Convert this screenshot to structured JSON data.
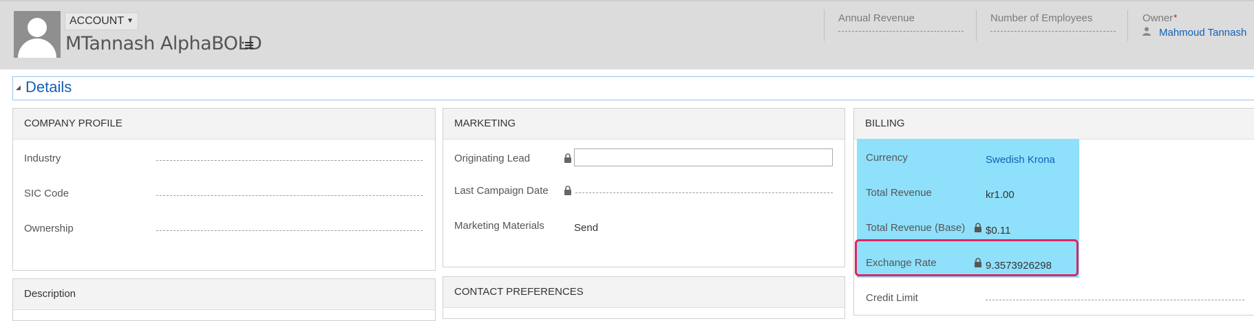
{
  "header": {
    "entity_type": "ACCOUNT",
    "record_name": "MTannash AlphaBOLD",
    "fields": {
      "annual_revenue_label": "Annual Revenue",
      "num_employees_label": "Number of Employees",
      "owner_label": "Owner",
      "owner_required_mark": "*",
      "owner_value": "Mahmoud Tannash"
    }
  },
  "details": {
    "title": "Details"
  },
  "company_profile": {
    "title": "COMPANY PROFILE",
    "rows": [
      {
        "label": "Industry"
      },
      {
        "label": "SIC Code"
      },
      {
        "label": "Ownership"
      }
    ]
  },
  "description": {
    "title": "Description"
  },
  "marketing": {
    "title": "MARKETING",
    "originating_lead_label": "Originating Lead",
    "last_campaign_date_label": "Last Campaign Date",
    "marketing_materials_label": "Marketing Materials",
    "marketing_materials_value": "Send"
  },
  "contact_preferences": {
    "title": "CONTACT PREFERENCES"
  },
  "billing": {
    "title": "BILLING",
    "currency_label": "Currency",
    "currency_value": "Swedish Krona",
    "total_revenue_label": "Total Revenue",
    "total_revenue_value": "kr1.00",
    "total_revenue_base_label": "Total Revenue (Base)",
    "total_revenue_base_value": "$0.11",
    "exchange_rate_label": "Exchange Rate",
    "exchange_rate_value": "9.3573926298",
    "credit_limit_label": "Credit Limit"
  },
  "colors": {
    "highlight": "#8fe0fb",
    "annotation_box": "#e0245e",
    "link": "#1160b7"
  }
}
